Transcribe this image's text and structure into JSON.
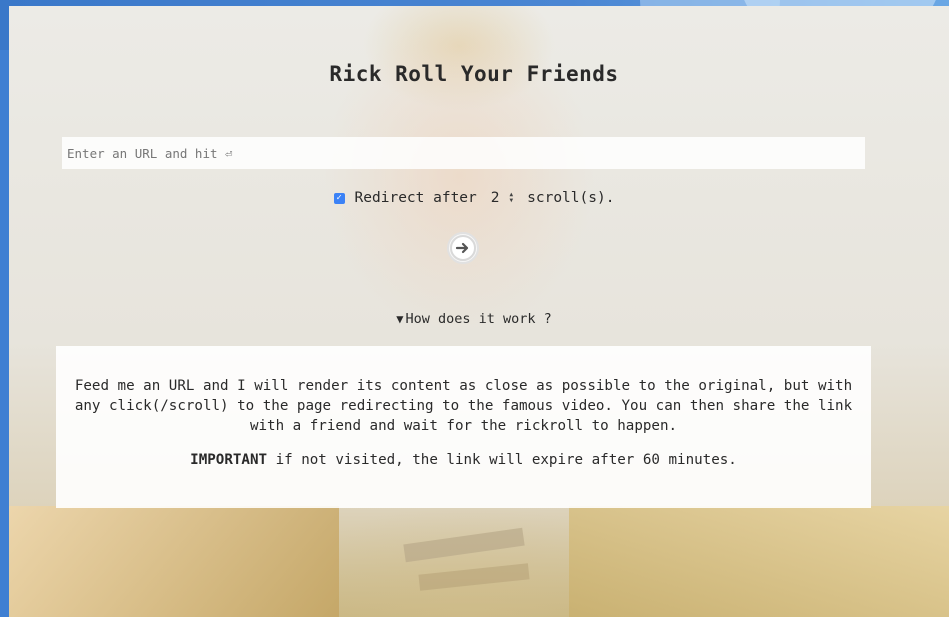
{
  "page": {
    "title": "Rick Roll Your Friends"
  },
  "url_input": {
    "placeholder": "Enter an URL and hit ⏎",
    "value": ""
  },
  "redirect": {
    "checked": true,
    "label_before": "Redirect after",
    "scroll_count": "2",
    "label_after": "scroll(s)."
  },
  "go_button": {
    "icon": "arrow-right-circle-icon"
  },
  "how_it_works": {
    "toggle_label": "How does it work ?",
    "expanded": true,
    "description": "Feed me an URL and I will render its content as close as possible to the original, but with any click(/scroll) to the page redirecting to the famous video. You can then share the link with a friend and wait for the rickroll to happen.",
    "important_label": "IMPORTANT",
    "important_text": " if not visited, the link will expire after 60 minutes."
  },
  "colors": {
    "accent": "#3b82f6",
    "title": "#2a2a2a",
    "frame": "#3f7fd2"
  }
}
